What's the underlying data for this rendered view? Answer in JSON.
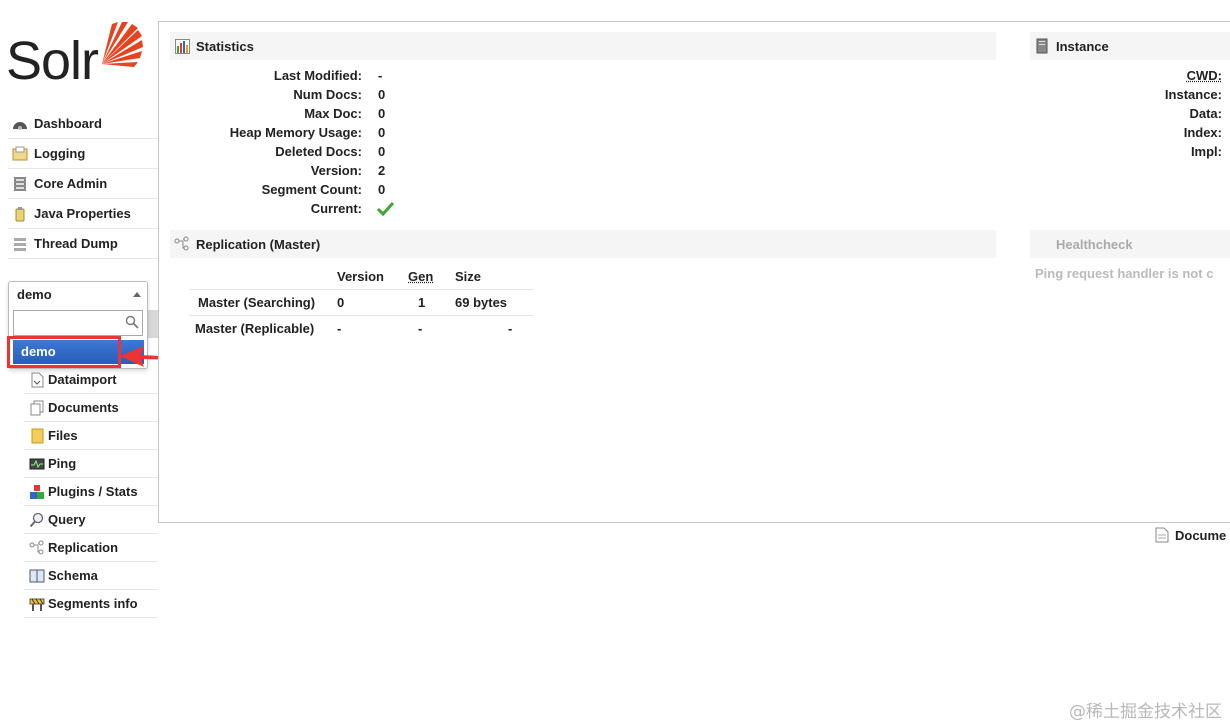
{
  "logo": {
    "text": "Solr"
  },
  "sidebar": {
    "items": [
      {
        "label": "Dashboard",
        "icon": "dashboard-icon"
      },
      {
        "label": "Logging",
        "icon": "logging-icon"
      },
      {
        "label": "Core Admin",
        "icon": "core-admin-icon"
      },
      {
        "label": "Java Properties",
        "icon": "java-properties-icon"
      },
      {
        "label": "Thread Dump",
        "icon": "thread-dump-icon"
      }
    ],
    "core_selector": {
      "selected": "demo",
      "search_placeholder": "",
      "options": [
        "demo"
      ]
    },
    "core_items": [
      {
        "label": "Dataimport",
        "icon": "dataimport-icon"
      },
      {
        "label": "Documents",
        "icon": "documents-icon"
      },
      {
        "label": "Files",
        "icon": "folder-icon"
      },
      {
        "label": "Ping",
        "icon": "ping-icon"
      },
      {
        "label": "Plugins / Stats",
        "icon": "plugins-icon"
      },
      {
        "label": "Query",
        "icon": "query-icon"
      },
      {
        "label": "Replication",
        "icon": "replication-icon"
      },
      {
        "label": "Schema",
        "icon": "schema-icon"
      },
      {
        "label": "Segments info",
        "icon": "segments-icon"
      }
    ]
  },
  "statistics": {
    "title": "Statistics",
    "rows": [
      {
        "key": "Last Modified:",
        "value": "-"
      },
      {
        "key": "Num Docs:",
        "value": "0"
      },
      {
        "key": "Max Doc:",
        "value": "0"
      },
      {
        "key": "Heap Memory Usage:",
        "value": "0"
      },
      {
        "key": "Deleted Docs:",
        "value": "0"
      },
      {
        "key": "Version:",
        "value": "2"
      },
      {
        "key": "Segment Count:",
        "value": "0"
      },
      {
        "key": "Current:",
        "value": ""
      }
    ]
  },
  "replication": {
    "title": "Replication (Master)",
    "headers": [
      "Version",
      "Gen",
      "Size"
    ],
    "rows": [
      {
        "label": "Master (Searching)",
        "version": "0",
        "gen": "1",
        "size": "69 bytes"
      },
      {
        "label": "Master (Replicable)",
        "version": "-",
        "gen": "-",
        "size": "-"
      }
    ]
  },
  "instance": {
    "title": "Instance",
    "keys": [
      "CWD:",
      "Instance:",
      "Data:",
      "Index:",
      "Impl:"
    ]
  },
  "healthcheck": {
    "title": "Healthcheck",
    "message": "Ping request handler is not c"
  },
  "docs_link": {
    "label": "Docume"
  },
  "watermark": "@稀土掘金技术社区",
  "colors": {
    "accent": "#2f64c4",
    "highlight": "#e33333",
    "check": "#3aa832",
    "logo_orange": "#e8431f"
  }
}
